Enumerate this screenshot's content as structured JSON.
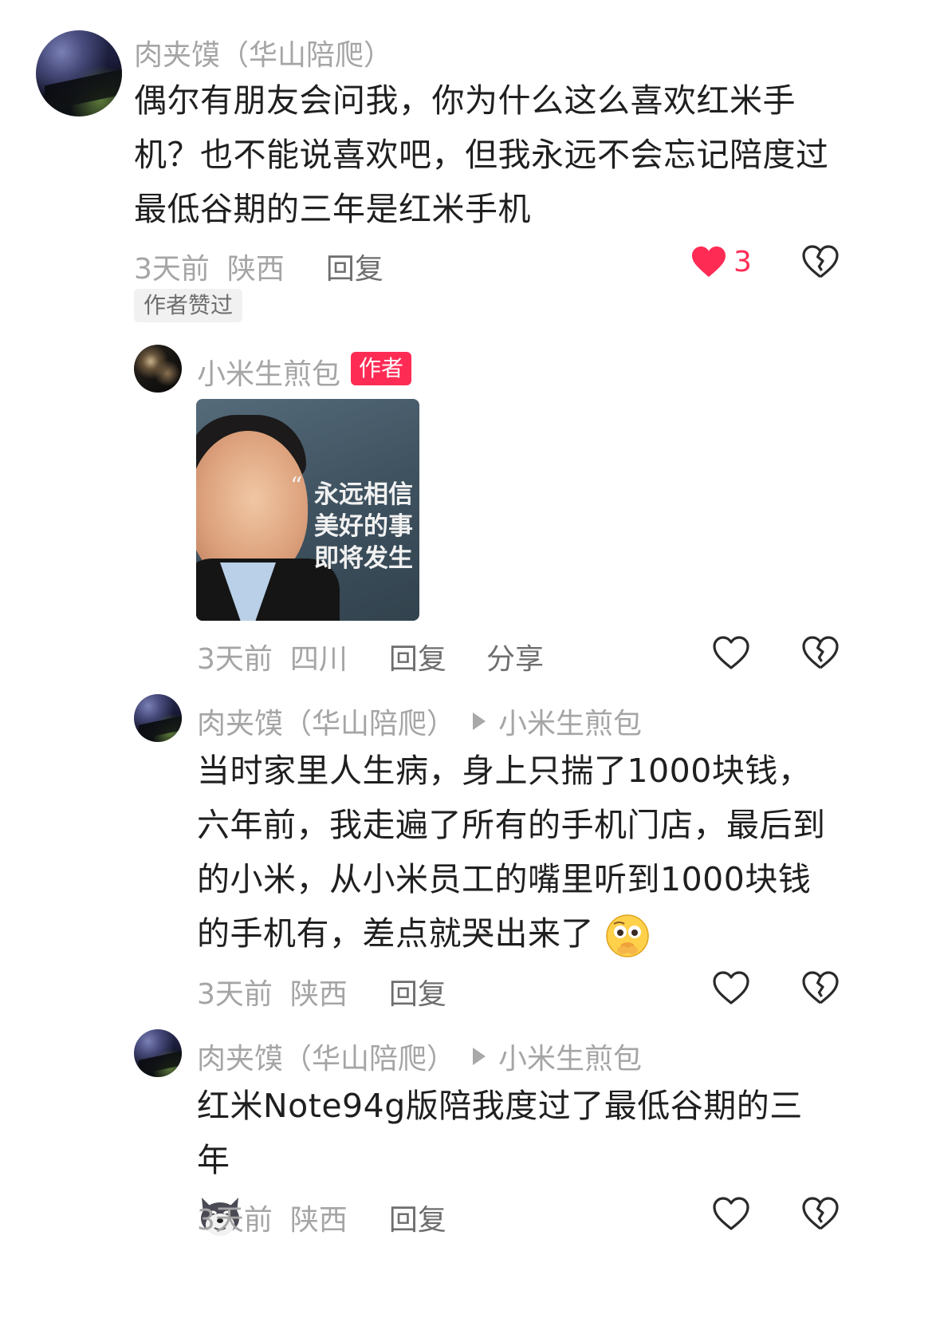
{
  "comments": [
    {
      "user": "肉夹馍（华山陪爬）",
      "text": "偶尔有朋友会问我，你为什么这么喜欢红米手机？也不能说喜欢吧，但我永远不会忘记陪度过最低谷期的三年是红米手机",
      "time": "3天前",
      "location": "陕西",
      "reply_label": "回复",
      "like_count": "3",
      "liked": true,
      "author_liked_tag": "作者赞过"
    },
    {
      "user": "小米生煎包",
      "author_badge": "作者",
      "image_quote": [
        "永远相信",
        "美好的事",
        "即将发生"
      ],
      "time": "3天前",
      "location": "四川",
      "reply_label": "回复",
      "share_label": "分享"
    },
    {
      "user": "肉夹馍（华山陪爬）",
      "reply_to": "小米生煎包",
      "text": "当时家里人生病，身上只揣了1000块钱，六年前，我走遍了所有的手机门店，最后到的小米，从小米员工的嘴里听到1000块钱的手机有，差点就哭出来了",
      "emoji": "pleading-face-emoji",
      "time": "3天前",
      "location": "陕西",
      "reply_label": "回复"
    },
    {
      "user": "肉夹馍（华山陪爬）",
      "reply_to": "小米生煎包",
      "text": "红米Note94g版陪我度过了最低谷期的三年",
      "emoji": "husky-dog-emoji",
      "time": "3天前",
      "location": "陕西",
      "reply_label": "回复"
    }
  ],
  "colors": {
    "accent": "#fe2c55",
    "meta_gray": "#a5a5a5",
    "text": "#1f1f1f"
  },
  "icons": [
    "heart-icon",
    "heart-outline-icon",
    "broken-heart-icon"
  ]
}
